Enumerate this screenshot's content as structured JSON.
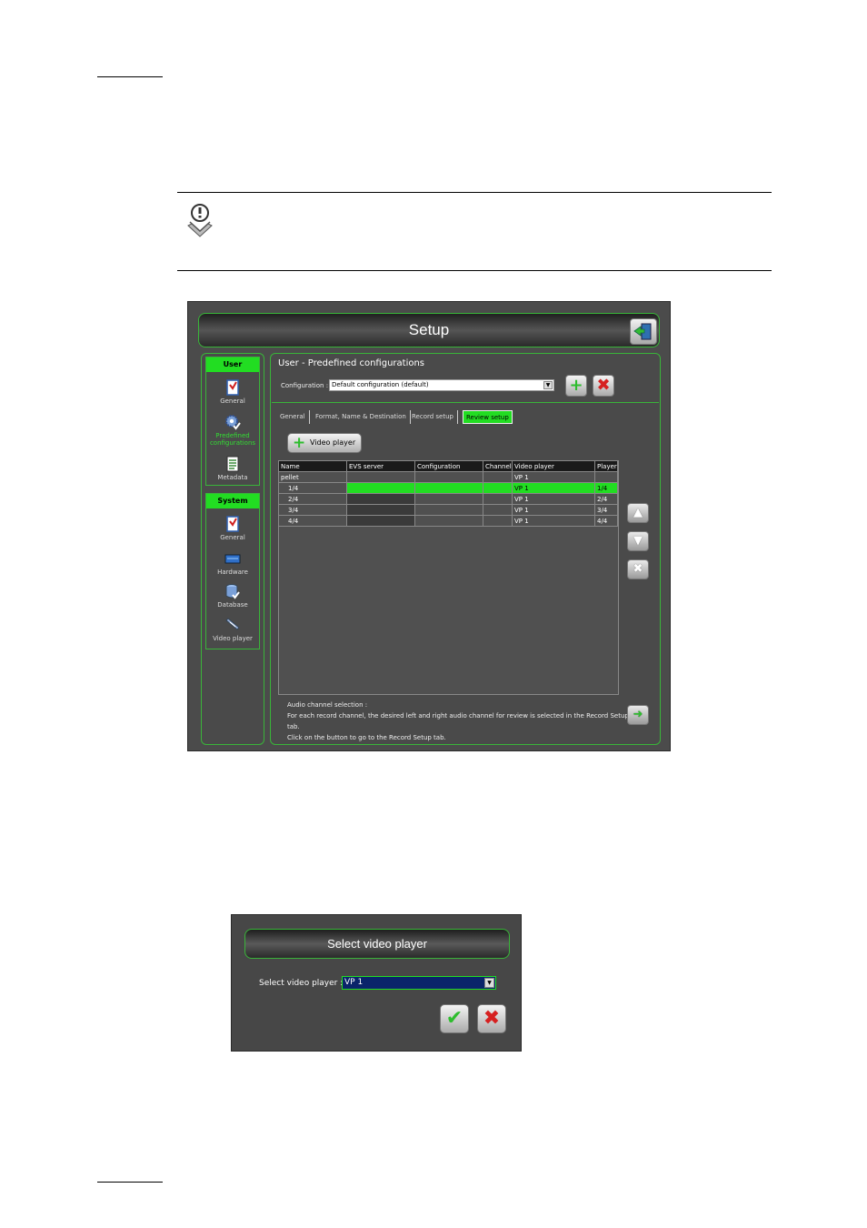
{
  "colors": {
    "accent_green": "#22dd22",
    "border_green": "#39b539",
    "panel_bg": "#4b4b4b",
    "cancel_red": "#d62020"
  },
  "note_icon": "note-icon",
  "setup": {
    "title": "Setup",
    "exit_icon": "exit-door-icon",
    "sidebar": {
      "user_group": "User",
      "user_items": [
        {
          "label": "General",
          "icon": "general-icon"
        },
        {
          "label": "Predefined configurations",
          "icon": "gear-check-icon"
        },
        {
          "label": "Metadata",
          "icon": "metadata-icon"
        }
      ],
      "system_group": "System",
      "system_items": [
        {
          "label": "General",
          "icon": "general-icon"
        },
        {
          "label": "Hardware",
          "icon": "hardware-icon"
        },
        {
          "label": "Database",
          "icon": "database-icon"
        },
        {
          "label": "Video player",
          "icon": "video-player-icon"
        }
      ]
    },
    "main": {
      "title": "User - Predefined configurations",
      "config_label": "Configuration :",
      "config_value": "Default configuration (default)",
      "tabs": [
        "General",
        "Format, Name & Destination",
        "Record setup",
        "Review setup"
      ],
      "active_tab": "Review setup",
      "video_player_button": "Video player",
      "table": {
        "columns": [
          "Name",
          "EVS server",
          "Configuration",
          "Channel",
          "Video player",
          "Player"
        ],
        "rows": [
          [
            "pellet",
            "",
            "",
            "",
            "VP 1",
            ""
          ],
          [
            "1/4",
            "",
            "",
            "",
            "VP 1",
            "1/4"
          ],
          [
            "2/4",
            "",
            "",
            "",
            "VP 1",
            "2/4"
          ],
          [
            "3/4",
            "",
            "",
            "",
            "VP 1",
            "3/4"
          ],
          [
            "4/4",
            "",
            "",
            "",
            "VP 1",
            "4/4"
          ]
        ],
        "selected_row": 1
      },
      "audio_title": "Audio channel selection :",
      "audio_line1": "For each record channel, the desired left and right audio channel for review is selected in the Record Setup tab.",
      "audio_line2": "Click on the button to go to the Record Setup tab."
    }
  },
  "dialog": {
    "title": "Select video player",
    "label": "Select video player :",
    "value": "VP 1",
    "ok_icon": "checkmark-icon",
    "cancel_icon": "cancel-x-icon"
  }
}
